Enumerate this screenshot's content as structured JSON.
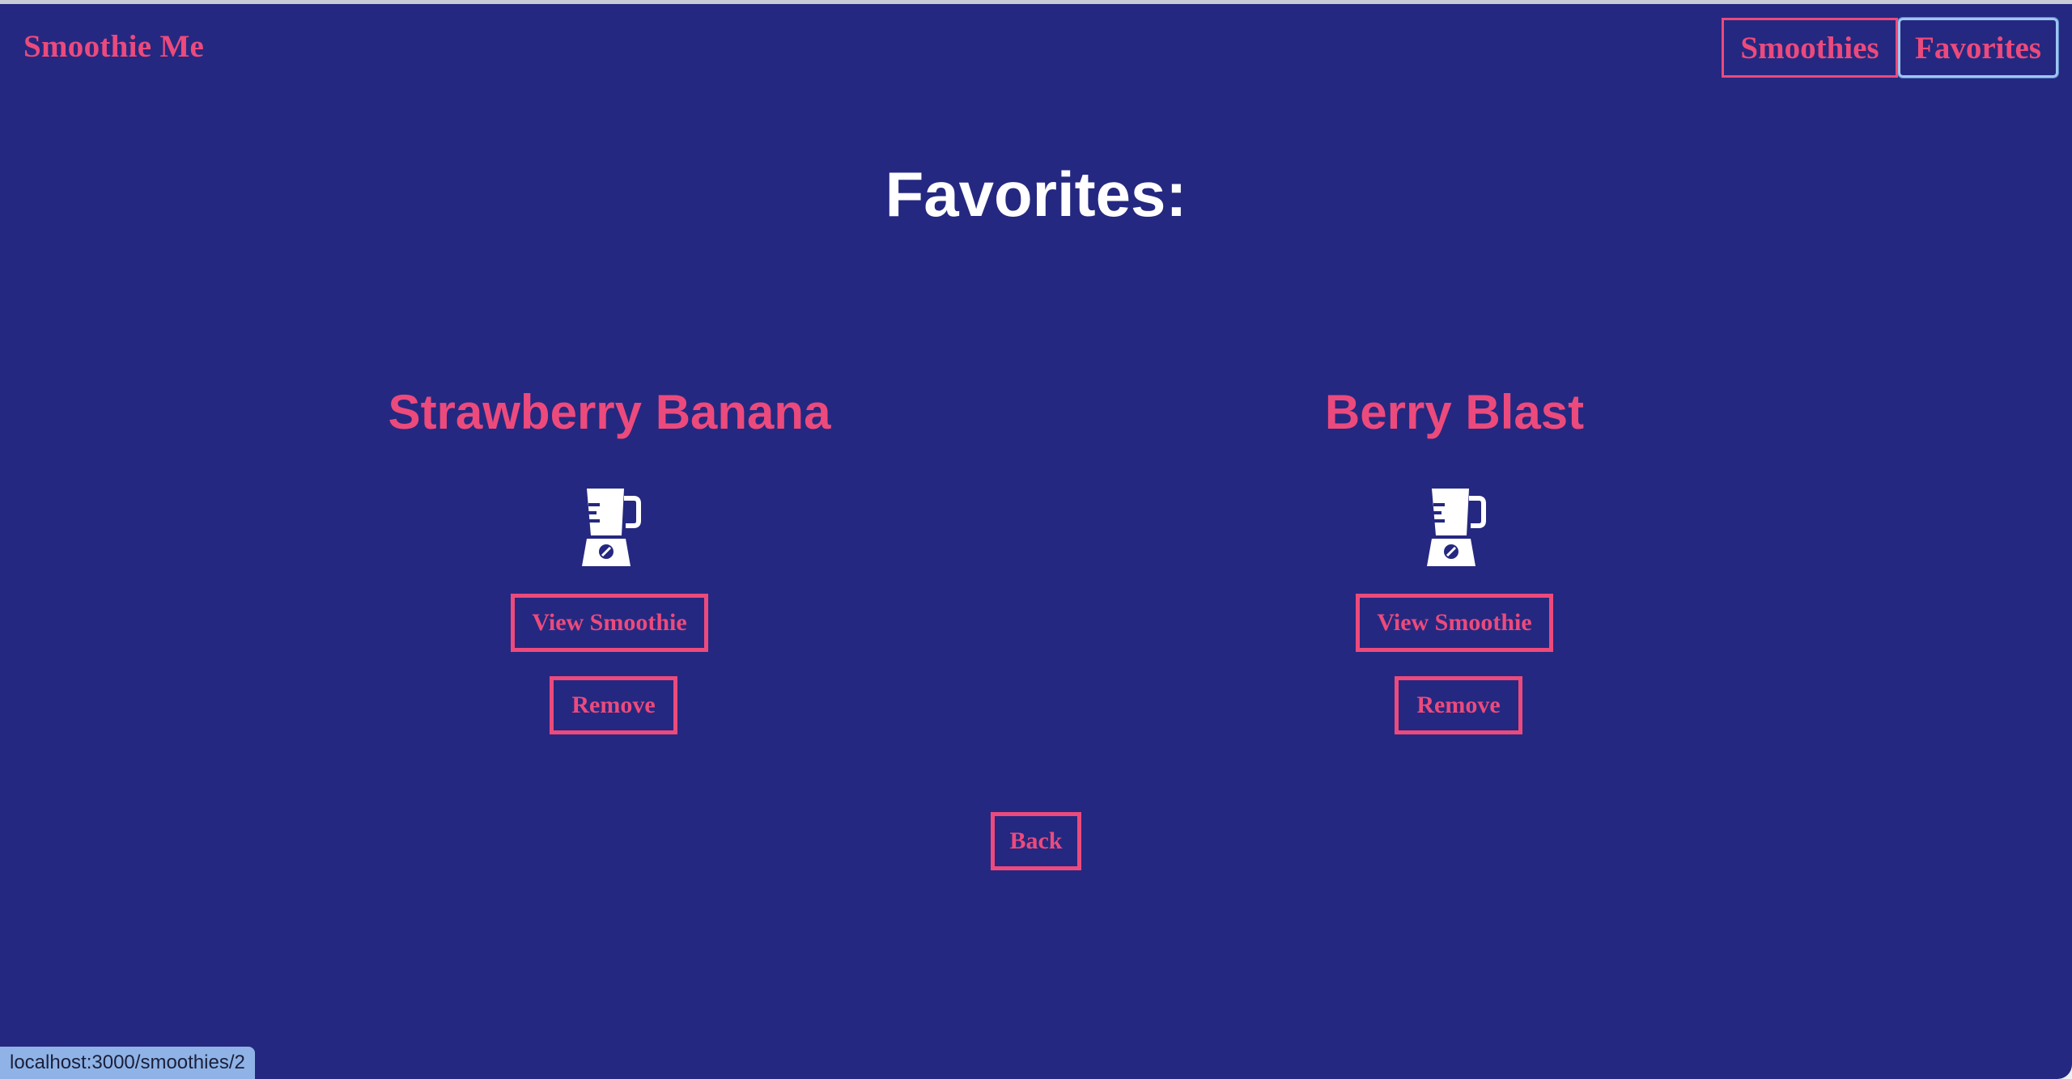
{
  "header": {
    "brand": "Smoothie Me",
    "nav": [
      {
        "label": "Smoothies"
      },
      {
        "label": "Favorites"
      }
    ]
  },
  "main": {
    "title": "Favorites:",
    "favorites": [
      {
        "name": "Strawberry Banana",
        "icon": "blender-icon",
        "view_label": "View Smoothie",
        "remove_label": "Remove"
      },
      {
        "name": "Berry Blast",
        "icon": "blender-icon",
        "view_label": "View Smoothie",
        "remove_label": "Remove"
      }
    ],
    "back_label": "Back"
  },
  "status_bar": {
    "url": "localhost:3000/smoothies/2"
  },
  "colors": {
    "background": "#252880",
    "accent": "#ec4a7c",
    "title": "#ffffff",
    "focus_outline": "#9fc6f2"
  }
}
